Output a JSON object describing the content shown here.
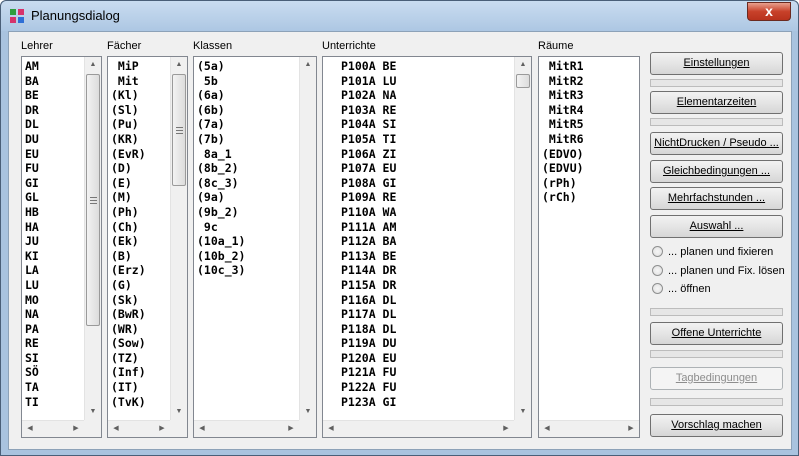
{
  "window": {
    "title": "Planungsdialog",
    "close_glyph": "x"
  },
  "columns": {
    "lehrer": {
      "label": "Lehrer",
      "items": [
        "AM",
        "BA",
        "BE",
        "DR",
        "DL",
        "DU",
        "EU",
        "FU",
        "GI",
        "GL",
        "HB",
        "HA",
        "JU",
        "KI",
        "LA",
        "LU",
        "MO",
        "NA",
        "PA",
        "RE",
        "SI",
        "SÖ",
        "TA",
        "TI"
      ]
    },
    "faecher": {
      "label": "Fächer",
      "items": [
        " MiP",
        " Mit",
        "(Kl)",
        "(Sl)",
        "(Pu)",
        "(KR)",
        "(EvR)",
        "(D)",
        "(E)",
        "(M)",
        "(Ph)",
        "(Ch)",
        "(Ek)",
        "(B)",
        "(Erz)",
        "(G)",
        "(Sk)",
        "(BwR)",
        "(WR)",
        "(Sow)",
        "(TZ)",
        "(Inf)",
        "(IT)",
        "(TvK)"
      ]
    },
    "klassen": {
      "label": "Klassen",
      "items": [
        "(5a)",
        " 5b",
        "(6a)",
        "(6b)",
        "(7a)",
        "(7b)",
        " 8a_1",
        "(8b_2)",
        "(8c_3)",
        "(9a)",
        "(9b_2)",
        " 9c",
        "(10a_1)",
        "(10b_2)",
        "(10c_3)"
      ]
    },
    "unterrichte": {
      "label": "Unterrichte",
      "items": [
        "P100A BE",
        "P101A LU",
        "P102A NA",
        "P103A RE",
        "P104A SI",
        "P105A TI",
        "P106A ZI",
        "P107A EU",
        "P108A GI",
        "P109A RE",
        "P110A WA",
        "P111A AM",
        "P112A BA",
        "P113A BE",
        "P114A DR",
        "P115A DR",
        "P116A DL",
        "P117A DL",
        "P118A DL",
        "P119A DU",
        "P120A EU",
        "P121A FU",
        "P122A FU",
        "P123A GI"
      ]
    },
    "raeume": {
      "label": "Räume",
      "items": [
        " MitR1",
        " MitR2",
        " MitR3",
        " MitR4",
        " MitR5",
        " MitR6",
        "(EDVO)",
        "(EDVU)",
        "(rPh)",
        "(rCh)"
      ]
    }
  },
  "buttons": {
    "einstellungen": "Einstellungen",
    "elementarzeiten": "Elementarzeiten",
    "nichtdrucken": "NichtDrucken / Pseudo ...",
    "gleichbedingungen": "Gleichbedingungen ...",
    "mehrfachstunden": "Mehrfachstunden ...",
    "auswahl": "Auswahl ...",
    "offene": "Offene Unterrichte",
    "tagbedingungen": "Tagbedingungen",
    "vorschlag": "Vorschlag machen"
  },
  "radios": [
    "... planen und fixieren",
    "... planen und Fix. lösen",
    "... öffnen"
  ],
  "glyphs": {
    "up": "▲",
    "down": "▼",
    "left": "◀",
    "right": "▶"
  },
  "colors": {
    "title_bar": "#adc7e3",
    "close_button": "#c8412a",
    "client_bg": "#f0f0f0"
  }
}
